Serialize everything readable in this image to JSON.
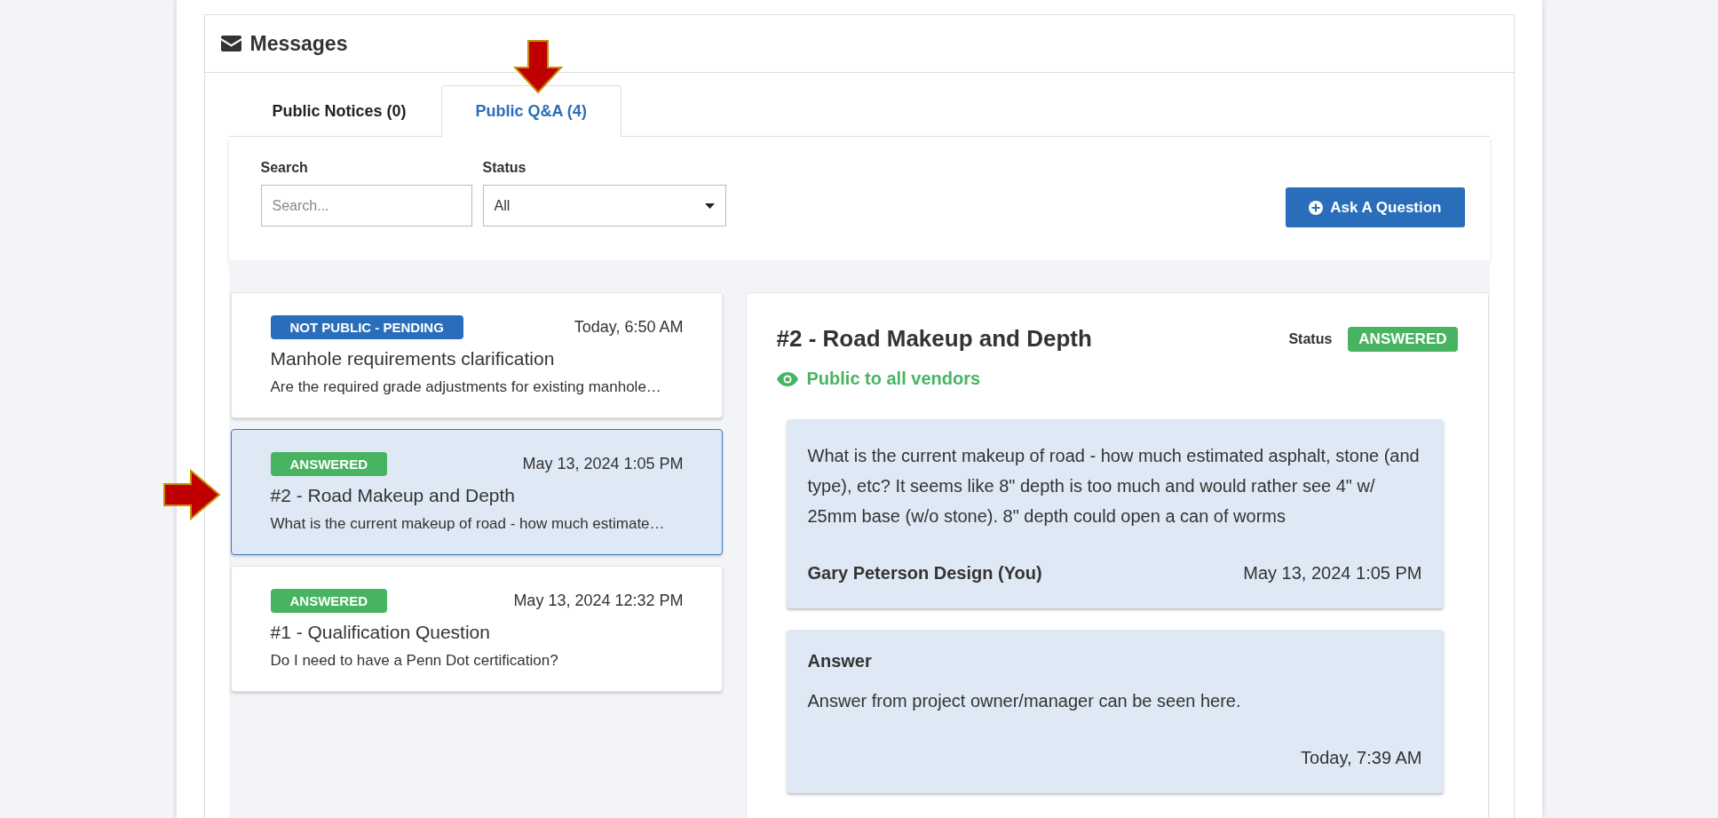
{
  "section": {
    "title": "Messages"
  },
  "tabs": [
    {
      "label": "Public Notices (0)",
      "selected": false
    },
    {
      "label": "Public Q&A (4)",
      "selected": true
    }
  ],
  "filters": {
    "search_label": "Search",
    "search_placeholder": "Search...",
    "status_label": "Status",
    "status_value": "All"
  },
  "ask_button": "Ask A Question",
  "questions": [
    {
      "badge": "NOT PUBLIC - PENDING",
      "kind": "pending",
      "time": "Today, 6:50 AM",
      "title": "Manhole requirements clarification",
      "preview": "Are the required grade adjustments for existing manhole…",
      "selected": false
    },
    {
      "badge": "ANSWERED",
      "kind": "answered",
      "time": "May 13, 2024 1:05 PM",
      "title": "#2 - Road Makeup and Depth",
      "preview": "What is the current makeup of road - how much estimate…",
      "selected": true
    },
    {
      "badge": "ANSWERED",
      "kind": "answered",
      "time": "May 13, 2024 12:32 PM",
      "title": "#1 - Qualification Question",
      "preview": "Do I need to have a Penn Dot certification?",
      "selected": false
    }
  ],
  "detail": {
    "title": "#2 - Road Makeup and Depth",
    "status_label": "Status",
    "status": "ANSWERED",
    "kind": "answered",
    "visibility": "Public to all vendors",
    "question": {
      "text": "What is the current makeup of road - how much estimated asphalt, stone (and type), etc? It seems like 8\" depth is too much and would rather see 4\" w/ 25mm base (w/o stone). 8\" depth could open a can of worms",
      "author": "Gary Peterson Design (You)",
      "time": "May 13, 2024 1:05 PM"
    },
    "answer": {
      "heading": "Answer",
      "text": "Answer from project owner/manager can be seen here.",
      "time": "Today, 7:39 AM"
    }
  }
}
